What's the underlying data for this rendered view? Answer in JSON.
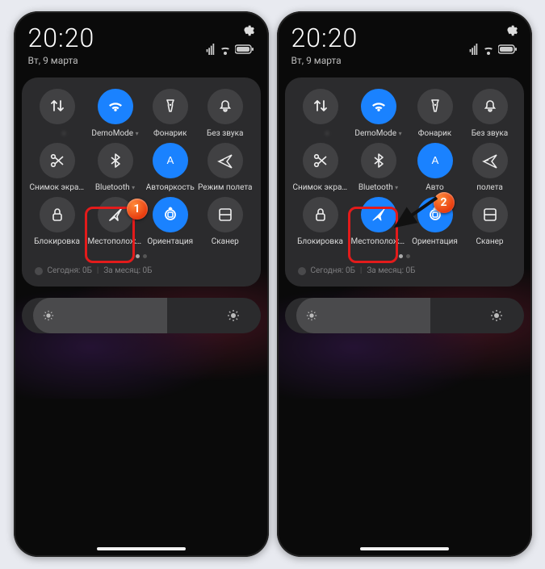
{
  "time": "20:20",
  "date": "Вт, 9 марта",
  "tiles": [
    {
      "icon": "data",
      "label": "",
      "blur": true,
      "chev": true
    },
    {
      "icon": "wifi",
      "label": "DemoMode",
      "active": true,
      "chev": true
    },
    {
      "icon": "torch",
      "label": "Фонарик"
    },
    {
      "icon": "bell",
      "label": "Без звука"
    },
    {
      "icon": "scissors",
      "label": "Снимок экрана"
    },
    {
      "icon": "bluetooth",
      "label": "Bluetooth",
      "chev": true
    },
    {
      "icon": "auto-a",
      "label": "Автояркость",
      "active": true
    },
    {
      "icon": "plane",
      "label": "Режим полета"
    },
    {
      "icon": "lock",
      "label": "Блокировка"
    },
    {
      "icon": "location",
      "label": "Местоположение"
    },
    {
      "icon": "rotate",
      "label": "Ориентация",
      "active": true
    },
    {
      "icon": "scan",
      "label": "Сканер"
    }
  ],
  "usage": {
    "today_label": "Сегодня:",
    "today_val": "0Б",
    "month_label": "За месяц:",
    "month_val": "0Б"
  },
  "callouts": {
    "left": "1",
    "right": "2"
  },
  "right_override": {
    "auto_label": "Авто",
    "plane_label": "полета"
  }
}
